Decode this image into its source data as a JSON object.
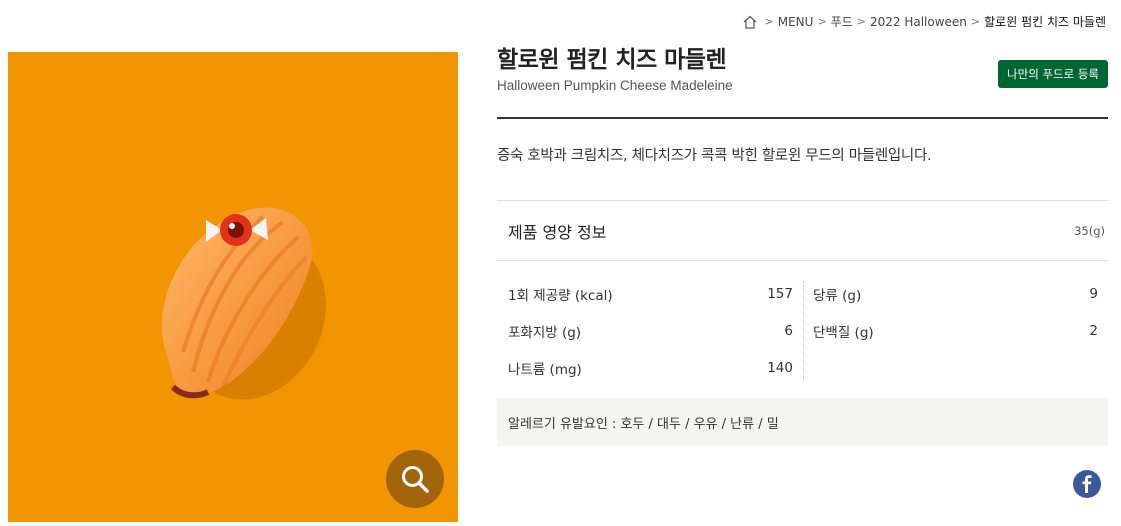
{
  "breadcrumb": {
    "icon": "home-icon",
    "items": [
      "MENU",
      "푸드",
      "2022 Halloween",
      "할로윈 펌킨 치즈 마들렌"
    ]
  },
  "product": {
    "title_ko": "할로윈 펌킨 치즈 마들렌",
    "title_en": "Halloween Pumpkin Cheese Madeleine",
    "register_label": "나만의 푸드로 등록",
    "description": "증숙 호박과 크림치즈, 체다치즈가 콕콕 박힌 할로윈 무드의 마들렌입니다."
  },
  "image": {
    "background_color": "#f19500",
    "zoom_icon": "magnifier-icon"
  },
  "nutrition": {
    "heading": "제품 영양 정보",
    "serving": "35(g)",
    "left": [
      {
        "label": "1회 제공량 (kcal)",
        "value": "157"
      },
      {
        "label": "포화지방 (g)",
        "value": "6"
      },
      {
        "label": "나트륨 (mg)",
        "value": "140"
      }
    ],
    "right": [
      {
        "label": "당류 (g)",
        "value": "9"
      },
      {
        "label": "단백질 (g)",
        "value": "2"
      }
    ]
  },
  "allergy": "알레르기 유발요인 : 호두 / 대두 / 우유 / 난류 / 밀",
  "share": {
    "icon": "facebook-icon"
  },
  "colors": {
    "brand_green": "#006633",
    "zoom_bg": "#a3650c",
    "facebook": "#3b5998"
  }
}
